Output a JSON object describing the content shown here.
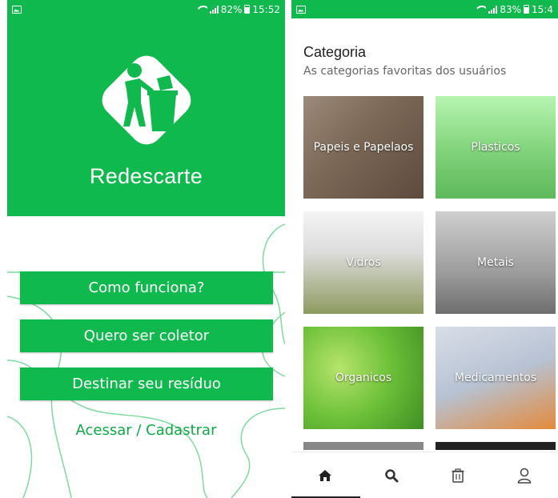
{
  "left": {
    "status": {
      "battery": "82%",
      "time": "15:52"
    },
    "app_name": "Redescarte",
    "buttons": [
      "Como funciona?",
      "Quero ser coletor",
      "Destinar seu resíduo"
    ],
    "link": "Acessar / Cadastrar"
  },
  "right": {
    "status": {
      "battery": "83%",
      "time": "15:4"
    },
    "title": "Categoria",
    "subtitle": "As categorias favoritas dos usuários",
    "categories": [
      "Papeis e Papelaos",
      "Plasticos",
      "Vidros",
      "Metais",
      "Organicos",
      "Medicamentos"
    ],
    "nav": [
      "home-icon",
      "search-icon",
      "trash-icon",
      "user-icon"
    ]
  },
  "colors": {
    "brand_green": "#10b94d",
    "link_green": "#10a846"
  }
}
